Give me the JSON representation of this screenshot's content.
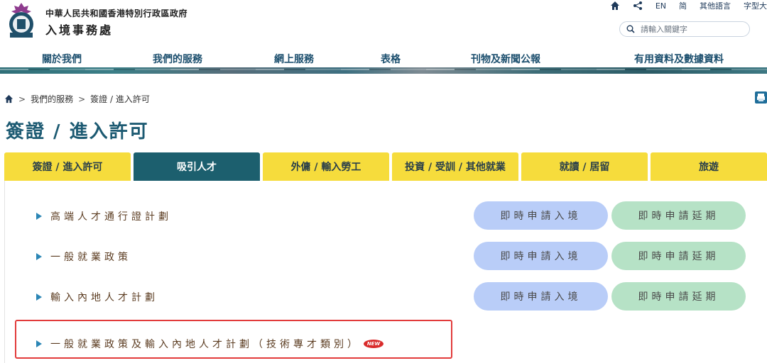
{
  "header": {
    "gov_name": "中華人民共和國香港特別行政區政府",
    "dept_name": "入境事務處",
    "utility": {
      "en": "EN",
      "simplified": "简",
      "other_languages": "其他語言",
      "font_size": "字型大"
    },
    "search": {
      "placeholder": "請輸入關鍵字"
    }
  },
  "nav": {
    "items": [
      "關於我們",
      "我們的服務",
      "網上服務",
      "表格",
      "刊物及新聞公報",
      "有用資料及數據資料"
    ]
  },
  "breadcrumb": {
    "items": [
      "我們的服務",
      "簽證 / 進入許可"
    ]
  },
  "page_title": "簽證 / 進入許可",
  "tabs": {
    "items": [
      "簽證 / 進入許可",
      "吸引人才",
      "外傭 / 輸入勞工",
      "投資 / 受訓 / 其他就業",
      "就讀 / 居留",
      "旅遊"
    ],
    "active_index": 1
  },
  "schemes": [
    {
      "label": "高端人才通行證計劃",
      "entry_button": "即時申請入境",
      "extend_button": "即時申請延期"
    },
    {
      "label": "一般就業政策",
      "entry_button": "即時申請入境",
      "extend_button": "即時申請延期"
    },
    {
      "label": "輸入內地人才計劃",
      "entry_button": "即時申請入境",
      "extend_button": "即時申請延期"
    },
    {
      "label": "一般就業政策及輸入內地人才計劃（技術專才類別）",
      "badge": "NEW"
    }
  ],
  "colors": {
    "tab_yellow": "#f6dc3c",
    "tab_active": "#1c5f6e",
    "entry_button": "#b9cdf8",
    "extend_button": "#b6e2c6",
    "highlight_border": "#e23b3b"
  }
}
